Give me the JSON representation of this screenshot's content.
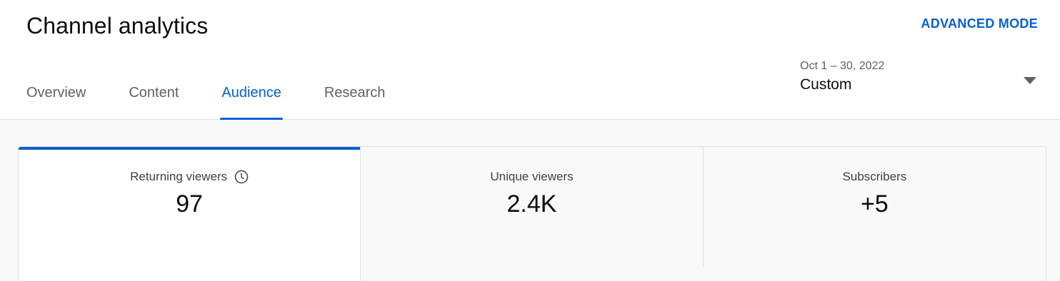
{
  "header": {
    "title": "Channel analytics",
    "advanced_mode_label": "ADVANCED MODE"
  },
  "tabs": [
    {
      "label": "Overview",
      "active": false
    },
    {
      "label": "Content",
      "active": false
    },
    {
      "label": "Audience",
      "active": true
    },
    {
      "label": "Research",
      "active": false
    }
  ],
  "date_picker": {
    "range": "Oct 1 – 30, 2022",
    "label": "Custom",
    "icon": "caret-down-icon"
  },
  "metrics": [
    {
      "label": "Returning viewers",
      "value": "97",
      "icon": "clock-icon",
      "active": true
    },
    {
      "label": "Unique viewers",
      "value": "2.4K",
      "active": false
    },
    {
      "label": "Subscribers",
      "value": "+5",
      "active": false
    }
  ],
  "colors": {
    "accent": "#065fd4",
    "text_primary": "#0d0d0d",
    "text_secondary": "#606060",
    "border": "#e0e0e0"
  }
}
